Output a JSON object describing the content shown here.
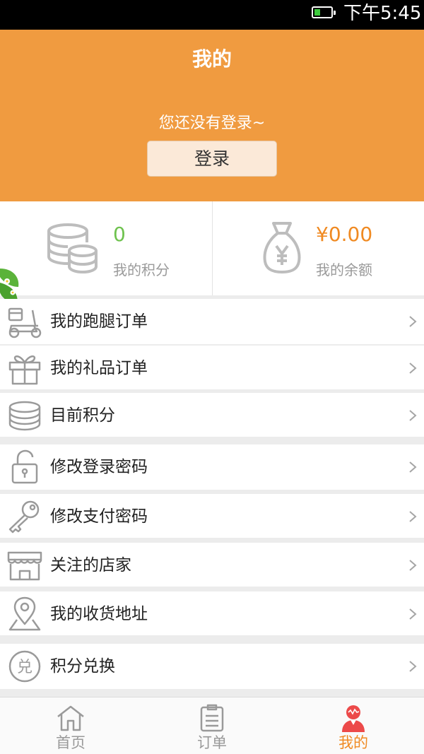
{
  "status_bar": {
    "time": "下午5:45"
  },
  "header": {
    "title": "我的",
    "login_hint": "您还没有登录~",
    "login_button": "登录"
  },
  "stats": {
    "points": {
      "value": "0",
      "label": "我的积分",
      "color": "#6ec24e"
    },
    "balance": {
      "value": "¥0.00",
      "label": "我的余额",
      "color": "#f08a22"
    }
  },
  "menu": {
    "items": [
      {
        "label": "我的跑腿订单",
        "icon": "scooter-icon"
      },
      {
        "label": "我的礼品订单",
        "icon": "gift-icon"
      },
      {
        "label": "目前积分",
        "icon": "coins-icon"
      },
      {
        "label": "修改登录密码",
        "icon": "padlock-icon"
      },
      {
        "label": "修改支付密码",
        "icon": "key-icon"
      },
      {
        "label": "关注的店家",
        "icon": "store-icon"
      },
      {
        "label": "我的收货地址",
        "icon": "location-pin-icon"
      },
      {
        "label": "积分兑换",
        "icon": "redeem-badge-icon",
        "badge_text": "兑"
      }
    ]
  },
  "tabbar": {
    "tabs": [
      {
        "label": "首页",
        "icon": "home-icon",
        "active": false
      },
      {
        "label": "订单",
        "icon": "clipboard-icon",
        "active": false
      },
      {
        "label": "我的",
        "icon": "user-icon",
        "active": true
      }
    ]
  },
  "colors": {
    "accent": "#f09b40",
    "active_tab": "#f08a22",
    "points_green": "#6ec24e"
  }
}
